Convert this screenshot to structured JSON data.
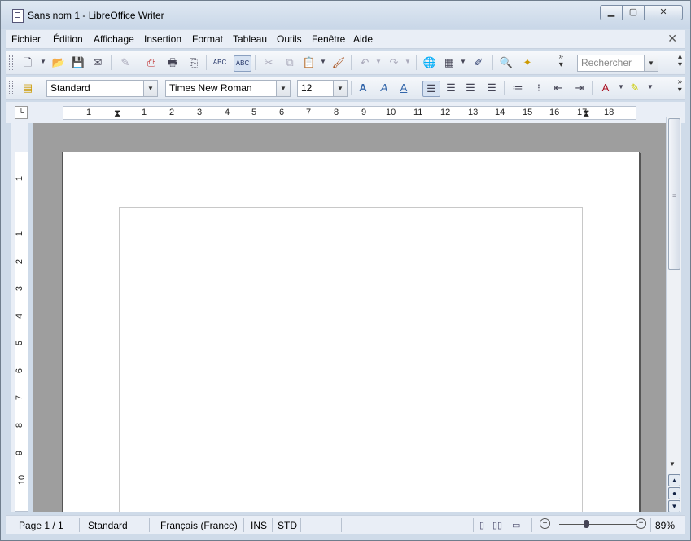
{
  "window": {
    "title": "Sans nom 1 - LibreOffice Writer",
    "minimize": "▁",
    "maximize": "▢",
    "close": "✕"
  },
  "menubar": {
    "items": [
      "Fichier",
      "Édition",
      "Affichage",
      "Insertion",
      "Format",
      "Tableau",
      "Outils",
      "Fenêtre",
      "Aide"
    ],
    "close": "✕"
  },
  "toolbar_standard": {
    "search_placeholder": "Rechercher",
    "icons": [
      "new-document-icon",
      "open-icon",
      "save-icon",
      "email-icon",
      "edit-mode-icon",
      "export-pdf-icon",
      "print-icon",
      "print-preview-icon",
      "spellcheck-icon",
      "autospellcheck-icon",
      "cut-icon",
      "copy-icon",
      "paste-icon",
      "clone-formatting-icon",
      "undo-icon",
      "redo-icon",
      "hyperlink-icon",
      "table-icon",
      "draw-icon",
      "find-replace-icon",
      "navigator-icon"
    ],
    "spellcheck_label": "ABC",
    "more": "»"
  },
  "toolbar_formatting": {
    "style": "Standard",
    "font": "Times New Roman",
    "size": "12",
    "more": "»"
  },
  "ruler": {
    "h_marks": [
      "1",
      "1",
      "2",
      "3",
      "4",
      "5",
      "6",
      "7",
      "8",
      "9",
      "10",
      "11",
      "12",
      "13",
      "14",
      "15",
      "16",
      "17",
      "18"
    ],
    "v_marks": [
      "1",
      "1",
      "2",
      "3",
      "4",
      "5",
      "6",
      "7",
      "8",
      "9",
      "10"
    ]
  },
  "statusbar": {
    "page": "Page 1 / 1",
    "style": "Standard",
    "language": "Français (France)",
    "insert_mode": "INS",
    "selection_mode": "STD",
    "zoom": "89%",
    "zoom_level": 0.89
  },
  "colors": {
    "window_frame": "#cfdbe9",
    "document_background": "#9e9e9e",
    "page": "#ffffff"
  }
}
